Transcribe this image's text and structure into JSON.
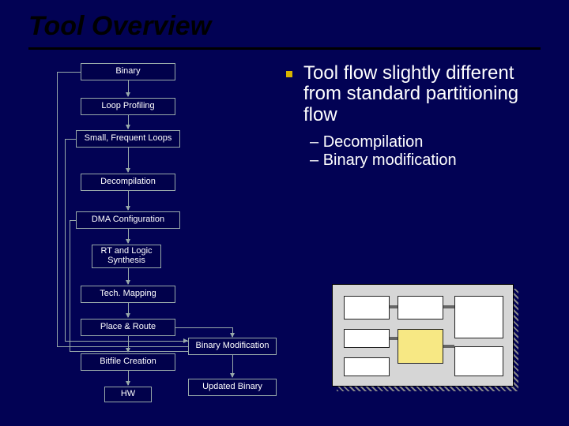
{
  "title": "Tool Overview",
  "bullets": {
    "main": "Tool flow slightly different from standard partitioning flow",
    "subs": [
      "Decompilation",
      "Binary modification"
    ]
  },
  "flow": {
    "binary": "Binary",
    "loop_profiling": "Loop Profiling",
    "small_frequent": "Small, Frequent Loops",
    "decompilation": "Decompilation",
    "dma_config": "DMA Configuration",
    "rt_logic": "RT and Logic Synthesis",
    "tech_mapping": "Tech. Mapping",
    "place_route": "Place & Route",
    "bitfile_creation": "Bitfile Creation",
    "hw": "HW",
    "binary_mod": "Binary Modification",
    "updated_binary": "Updated Binary"
  }
}
